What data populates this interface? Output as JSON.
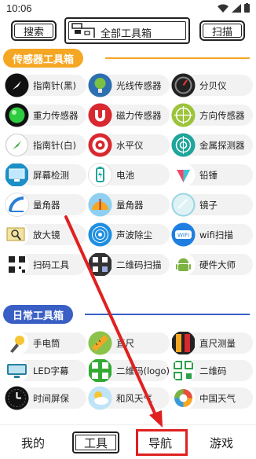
{
  "status_bar": {
    "time": "10:06"
  },
  "top_bar": {
    "search_label": "搜索",
    "all_tools_label": "全部工具箱",
    "scan_label": "扫描"
  },
  "sections": [
    {
      "title": "传感器工具箱",
      "accent": "#f5a623",
      "items": [
        {
          "label": "指南针(黑)",
          "icon": "compass-black-icon"
        },
        {
          "label": "光线传感器",
          "icon": "light-sensor-icon"
        },
        {
          "label": "分贝仪",
          "icon": "decibel-meter-icon"
        },
        {
          "label": "重力传感器",
          "icon": "gravity-sensor-icon"
        },
        {
          "label": "磁力传感器",
          "icon": "magnet-icon"
        },
        {
          "label": "方向传感器",
          "icon": "direction-sensor-icon"
        },
        {
          "label": "指南针(白)",
          "icon": "compass-white-icon"
        },
        {
          "label": "水平仪",
          "icon": "level-icon"
        },
        {
          "label": "金属探测器",
          "icon": "metal-detector-icon"
        },
        {
          "label": "屏幕检测",
          "icon": "screen-test-icon"
        },
        {
          "label": "电池",
          "icon": "battery-icon"
        },
        {
          "label": "铅锤",
          "icon": "plumb-icon"
        },
        {
          "label": "量角器",
          "icon": "protractor-icon"
        },
        {
          "label": "量角器",
          "icon": "angle-meter-icon"
        },
        {
          "label": "镜子",
          "icon": "mirror-icon"
        },
        {
          "label": "放大镜",
          "icon": "magnifier-icon"
        },
        {
          "label": "声波除尘",
          "icon": "sound-wave-icon"
        },
        {
          "label": "wifi扫描",
          "icon": "wifi-icon"
        },
        {
          "label": "扫码工具",
          "icon": "scan-code-icon"
        },
        {
          "label": "二维码扫描",
          "icon": "qrcode-scan-icon"
        },
        {
          "label": "硬件大师",
          "icon": "android-icon"
        }
      ]
    },
    {
      "title": "日常工具箱",
      "accent": "#3a5fc4",
      "items": [
        {
          "label": "手电筒",
          "icon": "flashlight-icon"
        },
        {
          "label": "直尺",
          "icon": "ruler-icon"
        },
        {
          "label": "直尺测量",
          "icon": "ruler-measure-icon"
        },
        {
          "label": "LED字幕",
          "icon": "led-icon"
        },
        {
          "label": "二维码(logo)",
          "icon": "qrcode-logo-icon"
        },
        {
          "label": "二维码",
          "icon": "qrcode-icon"
        },
        {
          "label": "时间屏保",
          "icon": "clock-icon"
        },
        {
          "label": "和风天气",
          "icon": "weather-icon"
        },
        {
          "label": "中国天气",
          "icon": "china-weather-icon"
        }
      ]
    }
  ],
  "bottom_nav": [
    {
      "label": "我的"
    },
    {
      "label": "工具"
    },
    {
      "label": "导航"
    },
    {
      "label": "游戏"
    }
  ],
  "annotation_color": "#e02020"
}
